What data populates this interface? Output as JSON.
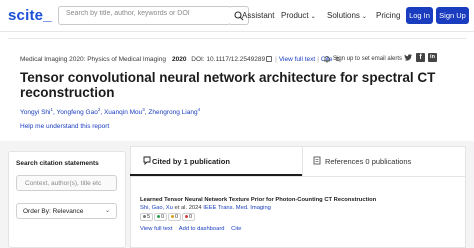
{
  "header": {
    "logo": "scite_",
    "search_placeholder": "Search by title, author, keywords or DOI",
    "nav": [
      {
        "label": "Assistant",
        "has_dropdown": false
      },
      {
        "label": "Product",
        "has_dropdown": true
      },
      {
        "label": "Solutions",
        "has_dropdown": true
      },
      {
        "label": "Pricing",
        "has_dropdown": false
      }
    ],
    "login": "Log In",
    "signup": "Sign Up"
  },
  "paper": {
    "venue": "Medical Imaging 2020: Physics of Medical Imaging",
    "year": "2020",
    "doi": "DOI: 10.1117/12.2549289",
    "view_full_text": "View full text",
    "cite": "Cite",
    "alert": "Sign up to set email alerts",
    "title": "Tensor convolutional neural network architecture for spectral CT reconstruction",
    "authors": [
      {
        "name": "Yongyi Shi",
        "sup": "1"
      },
      {
        "name": "Yongfeng Gao",
        "sup": "2"
      },
      {
        "name": "Xuanqin Mou",
        "sup": "3"
      },
      {
        "name": "Zhengrong Liang",
        "sup": "4"
      }
    ],
    "understand_link": "Help me understand this report"
  },
  "sidebar": {
    "search_label": "Search citation statements",
    "search_placeholder": "Context, author(s), title etc",
    "order_by": "Order By: Relevance"
  },
  "tabs": {
    "cited": "Cited by 1 publication",
    "references": "References 0 publications"
  },
  "citing": {
    "title": "Learned Tensor Neural Network Texture Prior for Photon-Counting CT Reconstruction",
    "authors": "Shi, Gao, Xu",
    "et_al": "et al.",
    "year": "2024",
    "journal": "IEEE Trans. Med. Imaging",
    "badges": [
      {
        "value": "5",
        "color": "#7a7a7a"
      },
      {
        "value": "0",
        "color": "#2e9e4d"
      },
      {
        "value": "0",
        "color": "#d89b1e"
      },
      {
        "value": "0",
        "color": "#d13f3f"
      }
    ],
    "actions": [
      "View full text",
      "Add to dashboard",
      "Cite"
    ]
  },
  "colors": {
    "brand": "#1b4fd8",
    "button": "#1a3dbf",
    "link": "#1a3dbf"
  }
}
